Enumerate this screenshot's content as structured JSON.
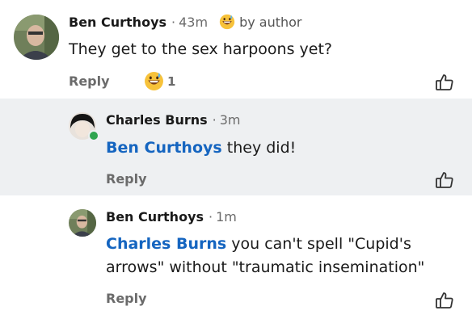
{
  "comments": [
    {
      "author": "Ben Curthoys",
      "separator": "·",
      "time": "43m",
      "badge": "by author",
      "text": "They get to the sex harpoons yet?",
      "reply_label": "Reply",
      "reaction_count": "1"
    },
    {
      "author": "Charles Burns",
      "separator": "·",
      "time": "3m",
      "mention": "Ben Curthoys",
      "text": " they did!",
      "reply_label": "Reply"
    },
    {
      "author": "Ben Curthoys",
      "separator": "·",
      "time": "1m",
      "mention": "Charles Burns",
      "text_line1": " you can't spell \"Cupid's",
      "text_line2": "arrows\" without \"traumatic insemination\"",
      "reply_label": "Reply"
    }
  ],
  "colors": {
    "mention": "#1565c0",
    "highlight_bg": "#eef0f2",
    "online": "#2ea44f"
  },
  "icons": {
    "reaction": "grinning-sweat-emoji-icon",
    "like": "thumbs-up-icon",
    "online": "online-status-dot"
  }
}
